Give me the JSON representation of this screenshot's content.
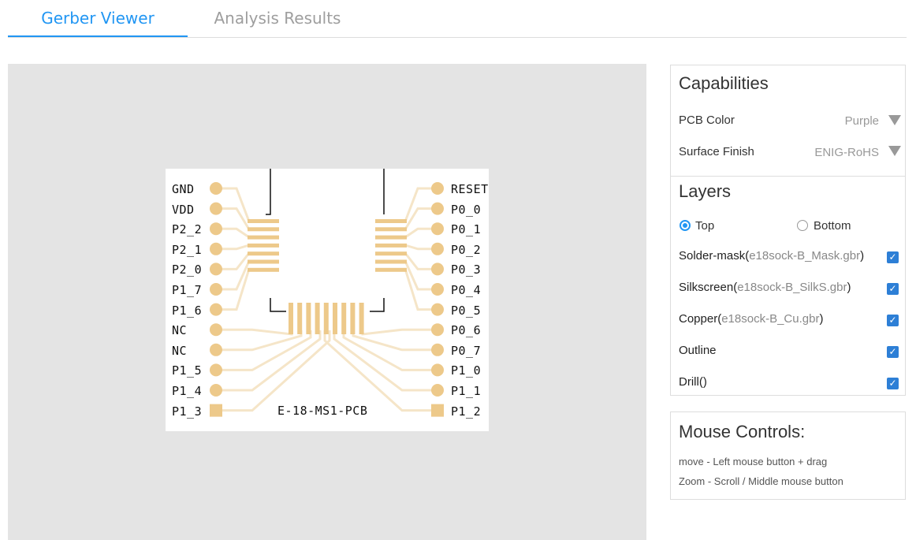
{
  "tabs": [
    {
      "label": "Gerber Viewer",
      "active": true
    },
    {
      "label": "Analysis Results",
      "active": false
    }
  ],
  "board": {
    "title": "E-18-MS1-PCB",
    "left_pins": [
      "GND",
      "VDD",
      "P2_2",
      "P2_1",
      "P2_0",
      "P1_7",
      "P1_6",
      "NC",
      "NC",
      "P1_5",
      "P1_4",
      "P1_3"
    ],
    "right_pins": [
      "RESET",
      "P0_0",
      "P0_1",
      "P0_2",
      "P0_3",
      "P0_4",
      "P0_5",
      "P0_6",
      "P0_7",
      "P1_0",
      "P1_1",
      "P1_2"
    ],
    "copper_color": "#edc98a",
    "trace_color": "#f5e5c8"
  },
  "capabilities": {
    "title": "Capabilities",
    "pcb_color_label": "PCB Color",
    "pcb_color_value": "Purple",
    "surface_finish_label": "Surface Finish",
    "surface_finish_value": "ENIG-RoHS"
  },
  "layers": {
    "title": "Layers",
    "top_label": "Top",
    "bottom_label": "Bottom",
    "selected": "Top",
    "items": [
      {
        "name": "Solder-mask",
        "file": "e18sock-B_Mask.gbr",
        "checked": true
      },
      {
        "name": "Silkscreen",
        "file": "e18sock-B_SilkS.gbr",
        "checked": true
      },
      {
        "name": "Copper",
        "file": "e18sock-B_Cu.gbr",
        "checked": true
      },
      {
        "name": "Outline",
        "file": "",
        "checked": true
      },
      {
        "name": "Drill",
        "file": "",
        "checked": true
      }
    ]
  },
  "mouse_controls": {
    "title": "Mouse Controls:",
    "line1": "move - Left mouse button + drag",
    "line2": "Zoom - Scroll / Middle mouse button"
  },
  "colors": {
    "accent": "#2196f3",
    "checkbox": "#2d7fd6",
    "viewer_bg": "#e4e4e4"
  }
}
